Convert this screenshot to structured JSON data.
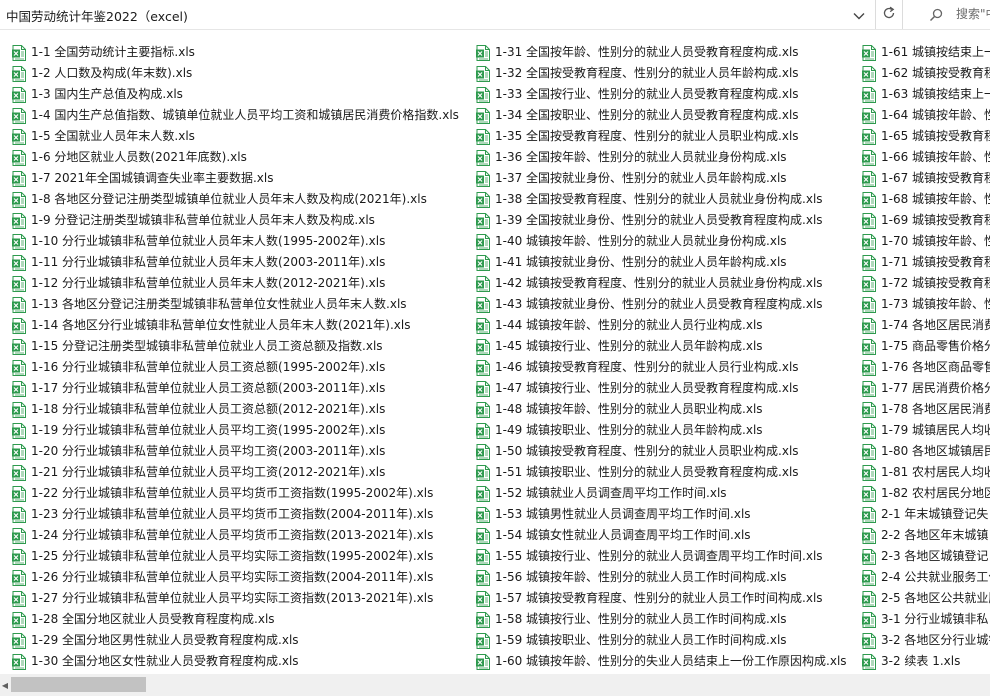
{
  "address_bar": {
    "path": "中国劳动统计年鉴2022（excel)",
    "search_placeholder": "搜索\"中国劳动统计年鉴2022（excel)\""
  },
  "icons": {
    "file": "excel-file-icon",
    "dropdown": "chevron-down-icon",
    "refresh": "refresh-icon",
    "search": "search-icon"
  },
  "colors": {
    "excel_green": "#2e9a4e",
    "scroll_thumb": "#c2c2c2"
  },
  "columns": [
    [
      "1-1 全国劳动统计主要指标.xls",
      "1-2 人口数及构成(年末数).xls",
      "1-3 国内生产总值及构成.xls",
      "1-4 国内生产总值指数、城镇单位就业人员平均工资和城镇居民消费价格指数.xls",
      "1-5 全国就业人员年末人数.xls",
      "1-6 分地区就业人员数(2021年底数).xls",
      "1-7 2021年全国城镇调查失业率主要数据.xls",
      "1-8 各地区分登记注册类型城镇单位就业人员年末人数及构成(2021年).xls",
      "1-9 分登记注册类型城镇非私营单位就业人员年末人数及构成.xls",
      "1-10 分行业城镇非私营单位就业人员年末人数(1995-2002年).xls",
      "1-11 分行业城镇非私营单位就业人员年末人数(2003-2011年).xls",
      "1-12 分行业城镇非私营单位就业人员年末人数(2012-2021年).xls",
      "1-13 各地区分登记注册类型城镇非私营单位女性就业人员年末人数.xls",
      "1-14 各地区分行业城镇非私营单位女性就业人员年末人数(2021年).xls",
      "1-15 分登记注册类型城镇非私营单位就业人员工资总额及指数.xls",
      "1-16 分行业城镇非私营单位就业人员工资总额(1995-2002年).xls",
      "1-17 分行业城镇非私营单位就业人员工资总额(2003-2011年).xls",
      "1-18 分行业城镇非私营单位就业人员工资总额(2012-2021年).xls",
      "1-19 分行业城镇非私营单位就业人员平均工资(1995-2002年).xls",
      "1-20 分行业城镇非私营单位就业人员平均工资(2003-2011年).xls",
      "1-21 分行业城镇非私营单位就业人员平均工资(2012-2021年).xls",
      "1-22 分行业城镇非私营单位就业人员平均货币工资指数(1995-2002年).xls",
      "1-23 分行业城镇非私营单位就业人员平均货币工资指数(2004-2011年).xls",
      "1-24 分行业城镇非私营单位就业人员平均货币工资指数(2013-2021年).xls",
      "1-25 分行业城镇非私营单位就业人员平均实际工资指数(1995-2002年).xls",
      "1-26 分行业城镇非私营单位就业人员平均实际工资指数(2004-2011年).xls",
      "1-27 分行业城镇非私营单位就业人员平均实际工资指数(2013-2021年).xls",
      "1-28 全国分地区就业人员受教育程度构成.xls",
      "1-29 全国分地区男性就业人员受教育程度构成.xls",
      "1-30 全国分地区女性就业人员受教育程度构成.xls"
    ],
    [
      "1-31 全国按年龄、性别分的就业人员受教育程度构成.xls",
      "1-32 全国按受教育程度、性别分的就业人员年龄构成.xls",
      "1-33 全国按行业、性别分的就业人员受教育程度构成.xls",
      "1-34 全国按职业、性别分的就业人员受教育程度构成.xls",
      "1-35 全国按受教育程度、性别分的就业人员职业构成.xls",
      "1-36 全国按年龄、性别分的就业人员就业身份构成.xls",
      "1-37 全国按就业身份、性别分的就业人员年龄构成.xls",
      "1-38 全国按受教育程度、性别分的就业人员就业身份构成.xls",
      "1-39 全国按就业身份、性别分的就业人员受教育程度构成.xls",
      "1-40 城镇按年龄、性别分的就业人员就业身份构成.xls",
      "1-41 城镇按就业身份、性别分的就业人员年龄构成.xls",
      "1-42 城镇按受教育程度、性别分的就业人员就业身份构成.xls",
      "1-43 城镇按就业身份、性别分的就业人员受教育程度构成.xls",
      "1-44 城镇按年龄、性别分的就业人员行业构成.xls",
      "1-45 城镇按行业、性别分的就业人员年龄构成.xls",
      "1-46 城镇按受教育程度、性别分的就业人员行业构成.xls",
      "1-47 城镇按行业、性别分的就业人员受教育程度构成.xls",
      "1-48 城镇按年龄、性别分的就业人员职业构成.xls",
      "1-49 城镇按职业、性别分的就业人员年龄构成.xls",
      "1-50 城镇按受教育程度、性别分的就业人员职业构成.xls",
      "1-51 城镇按职业、性别分的就业人员受教育程度构成.xls",
      "1-52 城镇就业人员调查周平均工作时间.xls",
      "1-53 城镇男性就业人员调查周平均工作时间.xls",
      "1-54 城镇女性就业人员调查周平均工作时间.xls",
      "1-55 城镇按行业、性别分的就业人员调查周平均工作时间.xls",
      "1-56 城镇按年龄、性别分的就业人员工作时间构成.xls",
      "1-57 城镇按受教育程度、性别分的就业人员工作时间构成.xls",
      "1-58 城镇按行业、性别分的就业人员工作时间构成.xls",
      "1-59 城镇按职业、性别分的就业人员工作时间构成.xls",
      "1-60 城镇按年龄、性别分的失业人员结束上一份工作原因构成.xls"
    ],
    [
      "1-61 城镇按结束上一",
      "1-62 城镇按受教育程",
      "1-63 城镇按结束上一",
      "1-64 城镇按年龄、性",
      "1-65 城镇按受教育程",
      "1-66 城镇按年龄、性",
      "1-67 城镇按受教育程",
      "1-68 城镇按年龄、性",
      "1-69 城镇按受教育程",
      "1-70 城镇按年龄、性",
      "1-71 城镇按受教育程",
      "1-72 城镇按受教育程",
      "1-73 城镇按年龄、性",
      "1-74 各地区居民消费",
      "1-75 商品零售价格分",
      "1-76 各地区商品零售",
      "1-77 居民消费价格分",
      "1-78 各地区居民消费",
      "1-79 城镇居民人均收",
      "1-80 各地区城镇居民",
      "1-81 农村居民人均收",
      "1-82 农村居民分地区",
      "2-1 年末城镇登记失",
      "2-2 各地区年末城镇",
      "2-3 各地区城镇登记",
      "2-4 公共就业服务工作",
      "2-5 各地区公共就业服",
      "3-1 分行业城镇非私",
      "3-2 各地区分行业城镇",
      "3-2 续表 1.xls"
    ]
  ]
}
